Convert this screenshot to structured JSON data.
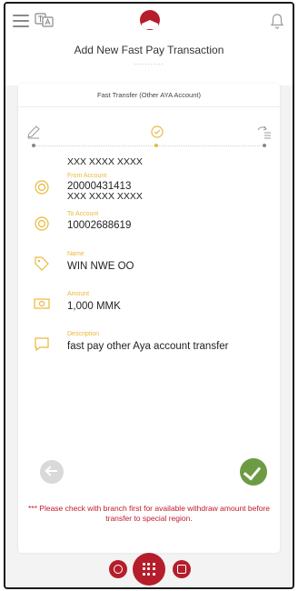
{
  "header": {
    "title": "Add New Fast Pay Transaction",
    "dots": "..........."
  },
  "transaction_type": "Fast Transfer (Other AYA Account)",
  "masked_account": "XXX XXXX XXXX",
  "fields": [
    {
      "label": "From Account",
      "value": "20000431413"
    },
    {
      "label": "To Account",
      "value": "10002688619"
    },
    {
      "label": "Name",
      "value": "WIN NWE OO"
    },
    {
      "label": "Amount",
      "value": "1,000 MMK"
    },
    {
      "label": "Description",
      "value": "fast pay other Aya account transfer"
    }
  ],
  "overlap_masked": "XXX XXXX XXXX",
  "warning": "*** Please check with branch first for available withdraw amount before transfer to special region.",
  "icons": {
    "menu": "menu-icon",
    "language": "language-icon",
    "logo": "aya-logo",
    "bell": "bell-icon",
    "step1": "pencil-icon",
    "step2": "check-circle-icon",
    "step3": "send-list-icon",
    "back": "back-arrow-icon",
    "confirm": "check-icon"
  },
  "colors": {
    "brand": "#b51d2a",
    "label": "#e9b93a",
    "confirm": "#6d9b44",
    "warning": "#c0192b"
  }
}
